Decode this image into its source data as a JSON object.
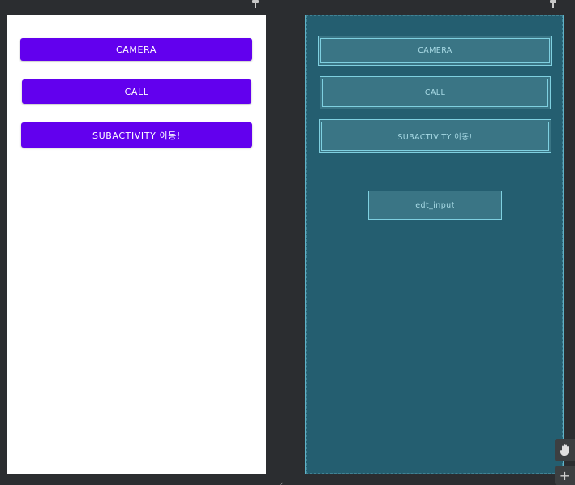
{
  "design_preview": {
    "buttons": {
      "camera": "CAMERA",
      "call": "CALL",
      "subactivity": "SUBACTIVITY 이동!"
    },
    "input_value": ""
  },
  "blueprint_preview": {
    "boxes": {
      "camera": "CAMERA",
      "call": "CALL",
      "subactivity": "SUBACTIVITY 이동!",
      "edt_input": "edt_input"
    }
  },
  "colors": {
    "button": "#6200ee",
    "blueprint_bg": "#245e70",
    "blueprint_line": "#7fd0e0",
    "editor_bg": "#2b2d30"
  },
  "icons": {
    "pin": "pin-icon",
    "pan": "hand-pan-icon",
    "zoom_in": "plus-icon",
    "resize": "resize-corner-icon"
  },
  "tools": {
    "zoom_in": "+"
  }
}
